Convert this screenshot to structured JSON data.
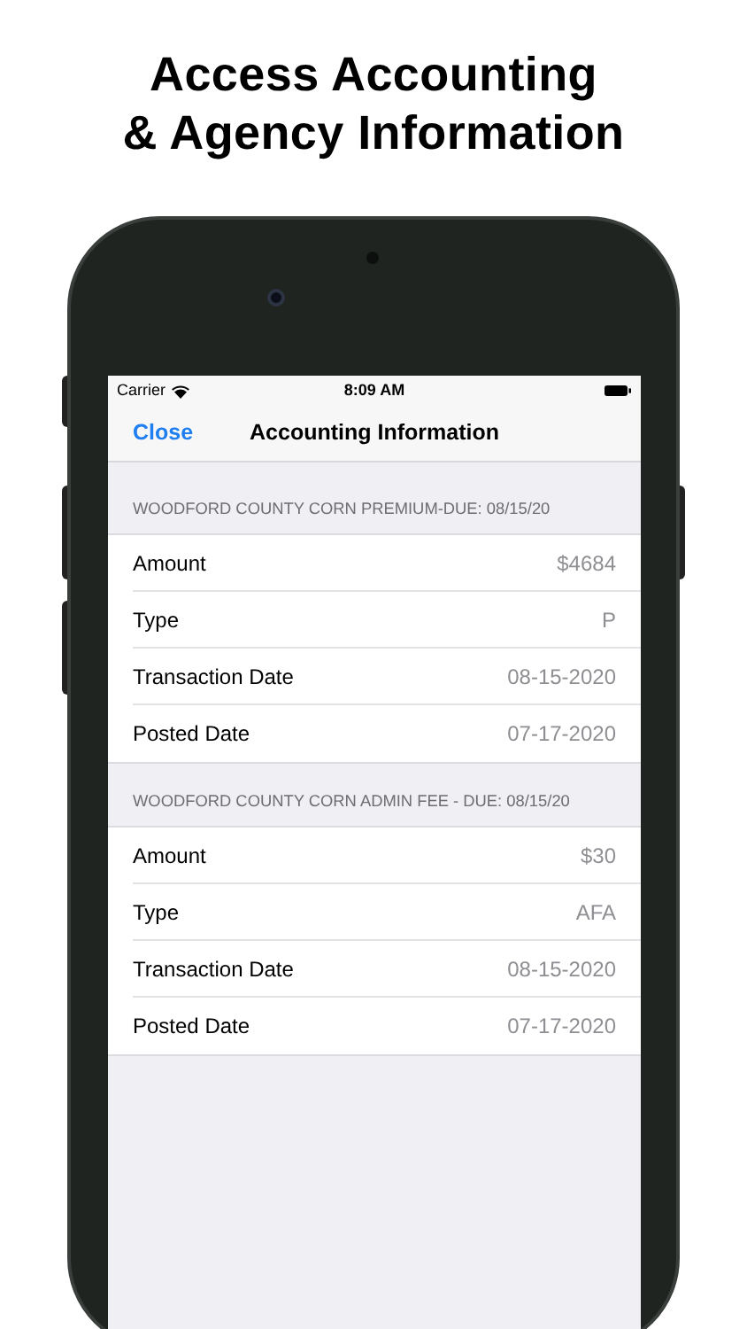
{
  "headline": [
    "Access Accounting",
    "& Agency Information"
  ],
  "status_bar": {
    "carrier": "Carrier",
    "time": "8:09 AM"
  },
  "nav_bar": {
    "close": "Close",
    "title": "Accounting Information"
  },
  "sections": [
    {
      "header": "WOODFORD COUNTY CORN PREMIUM-DUE: 08/15/20",
      "rows": [
        {
          "label": "Amount",
          "value": "$4684"
        },
        {
          "label": "Type",
          "value": "P"
        },
        {
          "label": "Transaction Date",
          "value": "08-15-2020"
        },
        {
          "label": "Posted Date",
          "value": "07-17-2020"
        }
      ]
    },
    {
      "header": "WOODFORD COUNTY CORN ADMIN FEE - DUE: 08/15/20",
      "rows": [
        {
          "label": "Amount",
          "value": "$30"
        },
        {
          "label": "Type",
          "value": "AFA"
        },
        {
          "label": "Transaction Date",
          "value": "08-15-2020"
        },
        {
          "label": "Posted Date",
          "value": "07-17-2020"
        }
      ]
    }
  ]
}
